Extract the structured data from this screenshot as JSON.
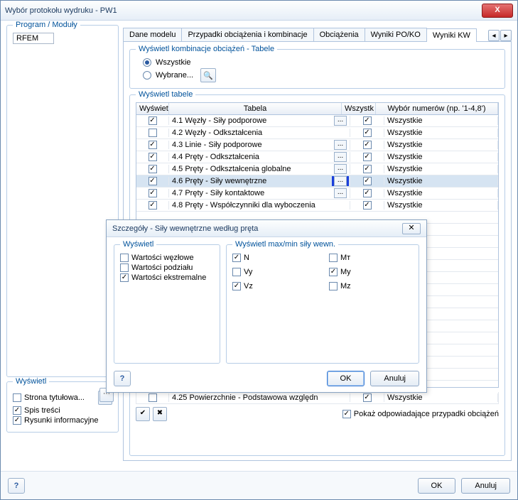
{
  "window": {
    "title": "Wybór protokołu wydruku - PW1"
  },
  "left": {
    "program_label": "Program / Moduły",
    "tree_item": "RFEM",
    "wyswietl_label": "Wyświetl",
    "opts": [
      {
        "label": "Strona tytułowa...",
        "checked": false
      },
      {
        "label": "Spis treści",
        "checked": true
      },
      {
        "label": "Rysunki informacyjne",
        "checked": true
      }
    ]
  },
  "tabs": {
    "items": [
      "Dane modelu",
      "Przypadki obciążenia i kombinacje",
      "Obciążenia",
      "Wyniki PO/KO",
      "Wyniki KW"
    ],
    "active": 4
  },
  "section1": {
    "title": "Wyświetl kombinacje obciążeń - Tabele",
    "r_all": "Wszystkie",
    "r_sel": "Wybrane..."
  },
  "section2": {
    "title": "Wyświetl tabele",
    "headers": {
      "c1": "Wyświet",
      "c2": "Tabela",
      "c3": "Wszystk",
      "c4": "Wybór numerów (np. '1-4,8')"
    },
    "rows": [
      {
        "show": true,
        "name": "4.1 Węzły - Siły podporowe",
        "ell": true,
        "all": true,
        "nums": "Wszystkie",
        "sel": false
      },
      {
        "show": false,
        "name": "4.2 Węzły - Odkształcenia",
        "ell": false,
        "all": true,
        "nums": "Wszystkie",
        "sel": false
      },
      {
        "show": true,
        "name": "4.3 Linie - Siły podporowe",
        "ell": true,
        "all": true,
        "nums": "Wszystkie",
        "sel": false
      },
      {
        "show": true,
        "name": "4.4 Pręty - Odkształcenia",
        "ell": true,
        "all": true,
        "nums": "Wszystkie",
        "sel": false
      },
      {
        "show": true,
        "name": "4.5 Pręty - Odkształcenia globalne",
        "ell": true,
        "all": true,
        "nums": "Wszystkie",
        "sel": false
      },
      {
        "show": true,
        "name": "4.6 Pręty - Siły wewnętrzne",
        "ell": true,
        "all": true,
        "nums": "Wszystkie",
        "sel": true,
        "hot": true
      },
      {
        "show": true,
        "name": "4.7 Pręty - Siły kontaktowe",
        "ell": true,
        "all": true,
        "nums": "Wszystkie",
        "sel": false
      },
      {
        "show": true,
        "name": "4.8 Pręty - Współczynniki dla wyboczenia",
        "ell": false,
        "all": true,
        "nums": "Wszystkie",
        "sel": false
      }
    ],
    "last_row": {
      "show": false,
      "name": "4.25 Powierzchnie - Podstawowa względn",
      "all": true,
      "nums": "Wszystkie"
    },
    "show_cases": "Pokaż odpowiadające przypadki obciążeń"
  },
  "dialog": {
    "title": "Szczegóły - Siły wewnętrzne według pręta",
    "left_title": "Wyświetl",
    "left_items": [
      {
        "label": "Wartości węzłowe",
        "checked": false
      },
      {
        "label": "Wartości podziału",
        "checked": false
      },
      {
        "label": "Wartości ekstremalne",
        "checked": true
      }
    ],
    "right_title": "Wyświetl max/min siły wewn.",
    "right_items": [
      {
        "label": "N",
        "checked": true
      },
      {
        "label": "Mᴛ",
        "checked": false
      },
      {
        "label": "Vy",
        "checked": false
      },
      {
        "label": "My",
        "checked": true
      },
      {
        "label": "Vz",
        "checked": true
      },
      {
        "label": "Mz",
        "checked": false
      }
    ],
    "ok": "OK",
    "cancel": "Anuluj"
  },
  "footer": {
    "ok": "OK",
    "cancel": "Anuluj"
  }
}
